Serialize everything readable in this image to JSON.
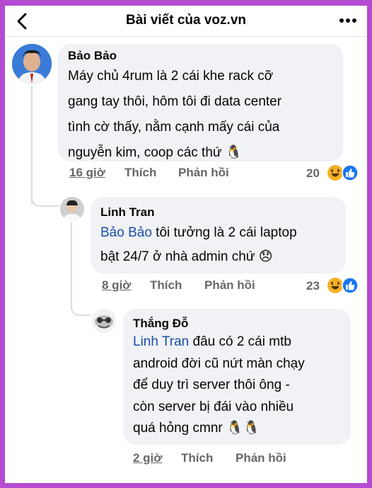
{
  "header": {
    "title": "Bài viết của voz.vn"
  },
  "comments": [
    {
      "author": "Bảo Bảo",
      "text": "Máy chủ 4rum là 2 cái khe rack cỡ gang tay thôi, hôm tôi đi data center tình cờ thấy, nằm cạnh mấy cái của nguyễn kim, coop các thứ 🐧",
      "lines": [
        "Máy chủ 4rum là 2 cái khe rack cỡ",
        "gang tay thôi, hôm tôi đi data center",
        "tình cờ thấy, nằm cạnh mấy cái của",
        "nguyễn kim, coop các thứ 🐧"
      ],
      "time": "16 giờ",
      "like_label": "Thích",
      "reply_label": "Phản hồi",
      "reaction_count": "20",
      "reactions": [
        "haha-icon",
        "like-icon"
      ]
    },
    {
      "author": "Linh Tran",
      "mention": "Bảo Bảo",
      "lines": [
        " tôi tưởng là 2 cái laptop",
        "bật 24/7 ở nhà admin chứ 😞"
      ],
      "time": "8 giờ",
      "like_label": "Thích",
      "reply_label": "Phản hồi",
      "reaction_count": "23",
      "reactions": [
        "haha-icon",
        "like-icon"
      ]
    },
    {
      "author": "Thắng Đỗ",
      "mention": "Linh Tran",
      "lines": [
        " đâu có 2 cái mtb",
        "android đời cũ nứt màn chạy",
        "để duy trì server thôi ông -",
        "còn server bị đái vào nhiều",
        "quá hỏng cmnr 🐧🐧"
      ],
      "time": "2 giờ",
      "like_label": "Thích",
      "reply_label": "Phản hồi"
    }
  ],
  "colors": {
    "frame": "#b54bd1",
    "bubble": "#f0f2f5",
    "mention": "#1b4fa8",
    "meta": "#65676b",
    "like_blue": "#1877f2",
    "haha_yellow": "#f7b125"
  }
}
